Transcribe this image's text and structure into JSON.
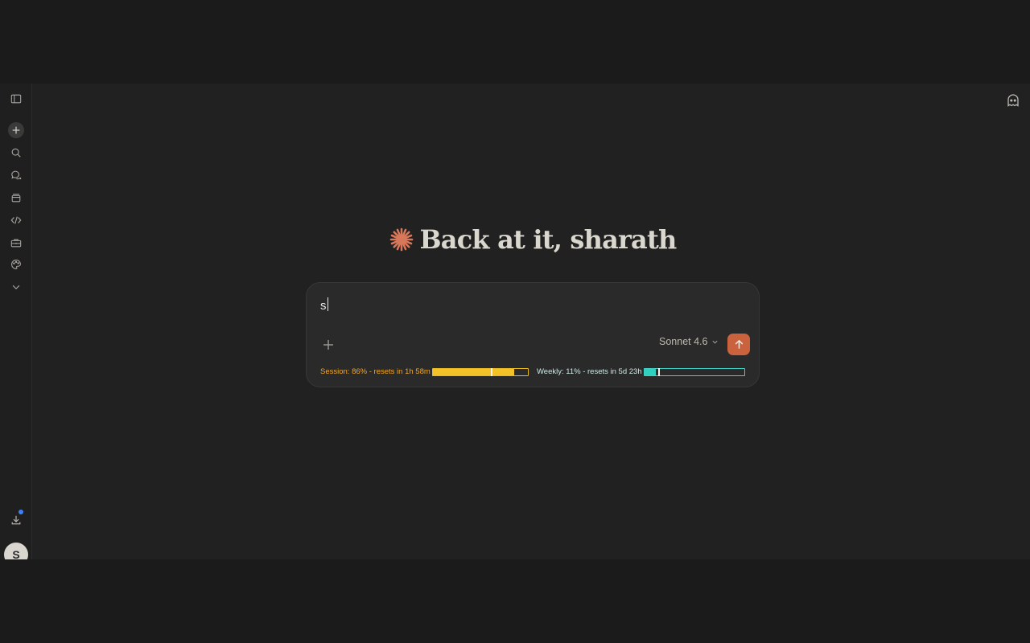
{
  "greeting": {
    "text": "Back at it, sharath",
    "logo_color": "#d9775a"
  },
  "composer": {
    "input_value": "s",
    "model_label": "Sonnet 4.6",
    "send_color": "#c9623d"
  },
  "usage": {
    "session": {
      "label": "Session: 86% - resets in 1h 58m",
      "percent": 86,
      "marker_percent": 61,
      "color": "#f2c228"
    },
    "weekly": {
      "label": "Weekly: 11% - resets in 5d 23h",
      "percent": 11,
      "marker_percent": 14,
      "color": "#2fd0c0"
    }
  },
  "sidebar": {
    "items": [
      {
        "icon": "sidebar-toggle-icon"
      },
      {
        "icon": "plus-icon"
      },
      {
        "icon": "search-icon"
      },
      {
        "icon": "chats-icon"
      },
      {
        "icon": "projects-icon"
      },
      {
        "icon": "code-icon"
      },
      {
        "icon": "toolbox-icon"
      },
      {
        "icon": "palette-icon"
      },
      {
        "icon": "chevron-down-icon"
      }
    ],
    "download_icon": "download-icon",
    "notification_dot_color": "#3b82f6",
    "avatar_initial": "S"
  },
  "header": {
    "incognito_icon": "ghost-icon"
  }
}
